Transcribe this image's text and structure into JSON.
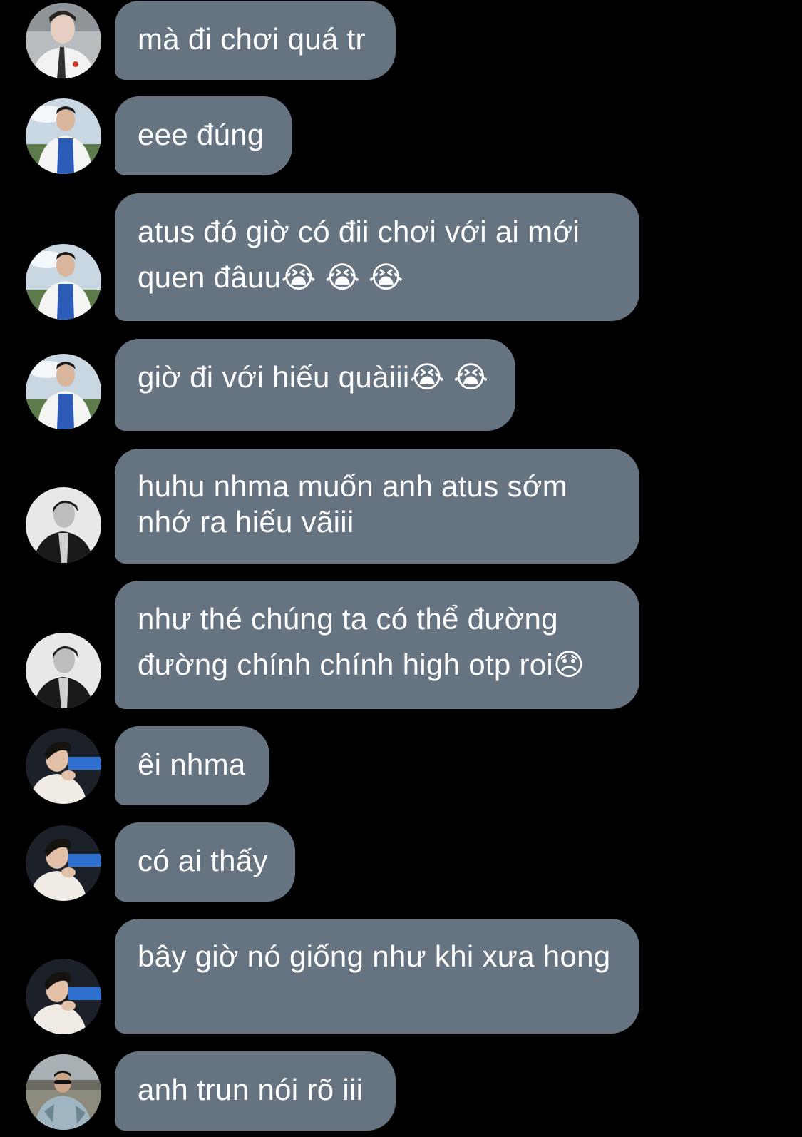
{
  "messages": [
    {
      "id": 1,
      "avatar": "avatar-user-school-uniform",
      "text": "mà đi chơi quá tr"
    },
    {
      "id": 2,
      "avatar": "avatar-user-white-jacket",
      "text": "eee đúng"
    },
    {
      "id": 3,
      "avatar": "avatar-user-white-jacket",
      "text": "atus đó giờ có đii chơi với ai mới quen đâuu😭 😭 😭"
    },
    {
      "id": 4,
      "avatar": "avatar-user-white-jacket",
      "text": "giờ đi với hiếu quàiii😭 😭"
    },
    {
      "id": 5,
      "avatar": "avatar-user-monochrome",
      "text": "huhu nhma muốn anh atus sớm nhớ ra hiếu vãiii"
    },
    {
      "id": 6,
      "avatar": "avatar-user-monochrome",
      "text": "như thé chúng ta có thể đường đường chính chính high otp roi😞"
    },
    {
      "id": 7,
      "avatar": "avatar-user-hand-on-chin",
      "text": "êi nhma"
    },
    {
      "id": 8,
      "avatar": "avatar-user-hand-on-chin",
      "text": "có ai thấy"
    },
    {
      "id": 9,
      "avatar": "avatar-user-hand-on-chin",
      "text": "bây giờ nó giống như khi xưa hong"
    },
    {
      "id": 10,
      "avatar": "avatar-user-denim-jacket",
      "text": "anh trun nói rõ iii"
    }
  ],
  "colors": {
    "background": "#000000",
    "bubble": "#667482",
    "text": "#ffffff"
  }
}
